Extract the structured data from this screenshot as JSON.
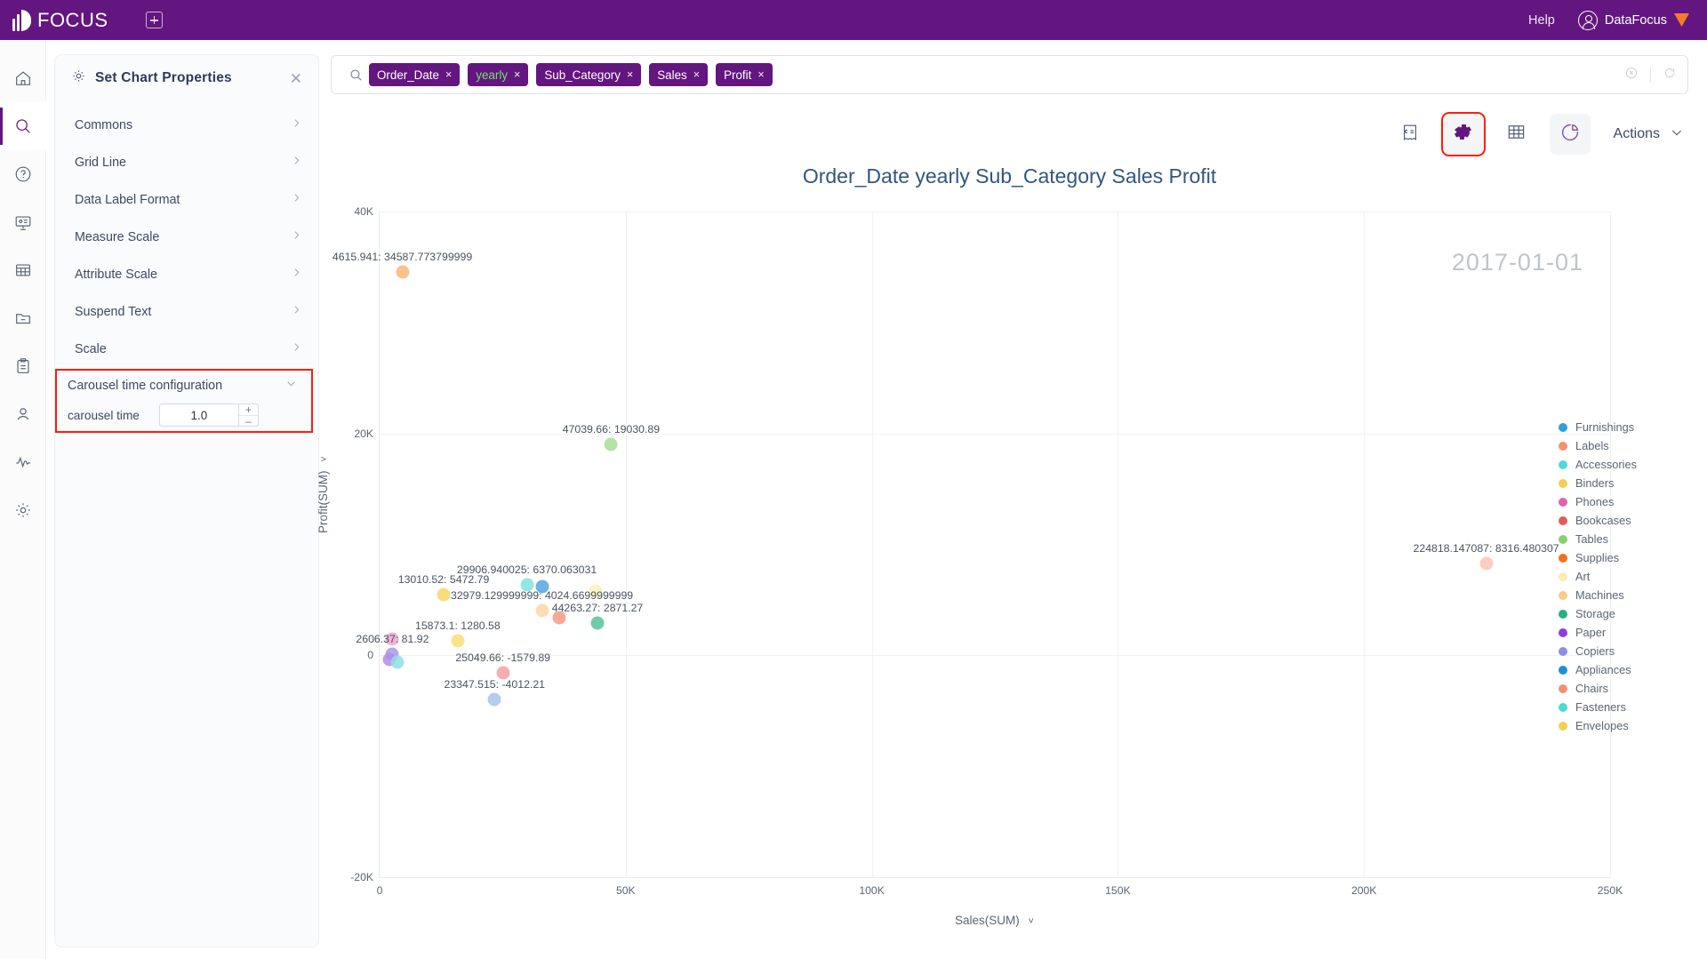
{
  "topbar": {
    "brand": "FOCUS",
    "add_icon": "plus-square-icon",
    "help": "Help",
    "user": "DataFocus"
  },
  "rail": [
    {
      "icon": "home-icon",
      "name": "home"
    },
    {
      "icon": "search-icon",
      "name": "search",
      "active": true
    },
    {
      "icon": "question-circle-icon",
      "name": "help"
    },
    {
      "icon": "presentation-icon",
      "name": "dashboard"
    },
    {
      "icon": "table-icon",
      "name": "table"
    },
    {
      "icon": "folder-minus-icon",
      "name": "resources"
    },
    {
      "icon": "clipboard-icon",
      "name": "tasks"
    },
    {
      "icon": "user-icon",
      "name": "account"
    },
    {
      "icon": "activity-icon",
      "name": "monitor"
    },
    {
      "icon": "gear-icon",
      "name": "settings"
    }
  ],
  "panel": {
    "title": "Set Chart Properties",
    "gear_icon": "gear-icon",
    "close_icon": "close-icon",
    "items": [
      {
        "label": "Commons"
      },
      {
        "label": "Grid Line"
      },
      {
        "label": "Data Label Format"
      },
      {
        "label": "Measure Scale"
      },
      {
        "label": "Attribute Scale"
      },
      {
        "label": "Suspend Text"
      },
      {
        "label": "Scale"
      }
    ],
    "carousel": {
      "section_label": "Carousel time configuration",
      "field_label": "carousel time",
      "value": "1.0",
      "increment": "+",
      "decrement": "–",
      "highlight_color": "#fd1d0a"
    }
  },
  "search": {
    "icon": "search-icon",
    "tokens": [
      {
        "label": "Order_Date",
        "remove": "×",
        "style": "plain"
      },
      {
        "label": "yearly",
        "remove": "×",
        "style": "green"
      },
      {
        "label": "Sub_Category",
        "remove": "×",
        "style": "plain"
      },
      {
        "label": "Sales",
        "remove": "×",
        "style": "plain"
      },
      {
        "label": "Profit",
        "remove": "×",
        "style": "plain"
      }
    ],
    "clear_icon": "circle-x-icon",
    "refresh_icon": "refresh-icon"
  },
  "toolbar": {
    "buttons": [
      {
        "icon": "receipt-icon",
        "name": "answer-view",
        "state": "plain"
      },
      {
        "icon": "gear-icon",
        "name": "chart-properties",
        "state": "highlighted"
      },
      {
        "icon": "table-icon",
        "name": "table-view",
        "state": "plain"
      },
      {
        "icon": "pie-chart-icon",
        "name": "chart-type",
        "state": "tinted"
      }
    ],
    "actions_label": "Actions",
    "actions_chevron": "chevron-down-icon"
  },
  "chart_data": {
    "type": "scatter",
    "title": "Order_Date yearly Sub_Category Sales Profit",
    "xlabel": "Sales(SUM)",
    "ylabel": "Profit(SUM)",
    "annotation": "2017-01-01",
    "xlim": [
      0,
      250000
    ],
    "ylim": [
      -20000,
      40000
    ],
    "xticks": [
      "0",
      "50K",
      "100K",
      "150K",
      "200K",
      "250K"
    ],
    "xtick_values": [
      0,
      50000,
      100000,
      150000,
      200000,
      250000
    ],
    "yticks": [
      "-20K",
      "0",
      "20K",
      "40K"
    ],
    "ytick_values": [
      -20000,
      0,
      20000,
      40000
    ],
    "grid": true,
    "legend_position": "right",
    "points": [
      {
        "series": "Machines",
        "x": 4615.941,
        "y": 34587.773799999,
        "label": "4615.941: 34587.773799999",
        "color": "#f9b87d"
      },
      {
        "series": "Tables",
        "x": 47039.66,
        "y": 19030.89,
        "label": "47039.66: 19030.89",
        "color": "#a8dd9a"
      },
      {
        "series": "Labels",
        "x": 224818.147087,
        "y": 8316.480307,
        "label": "224818.147087: 8316.480307",
        "color": "#fcc6b4"
      },
      {
        "series": "Accessories",
        "x": 29906.940025,
        "y": 6370.063031,
        "label": "29906.940025: 6370.063031",
        "color": "#7fe3e0"
      },
      {
        "series": "Appliances",
        "x": 32979.129999999,
        "y": 6200.0,
        "label": "",
        "color": "#57a5e0"
      },
      {
        "series": "Binders",
        "x": 13010.52,
        "y": 5472.79,
        "label": "13010.52: 5472.79",
        "color": "#f6d86b"
      },
      {
        "series": "Art",
        "x": 43900.0,
        "y": 5800.0,
        "label": "",
        "color": "#fbf0bc"
      },
      {
        "series": "Machines",
        "x": 32979.129999999,
        "y": 4024.6699999999,
        "label": "32979.129999999: 4024.6699999999",
        "color": "#fcd9a5"
      },
      {
        "series": "Chairs",
        "x": 36500.0,
        "y": 3400.0,
        "label": "",
        "color": "#f79b82"
      },
      {
        "series": "Storage",
        "x": 44263.27,
        "y": 2871.27,
        "label": "44263.27: 2871.27",
        "color": "#58c49a"
      },
      {
        "series": "Envelopes",
        "x": 15873.1,
        "y": 1280.58,
        "label": "15873.1: 1280.58",
        "color": "#f8e07a"
      },
      {
        "series": "Phones",
        "x": 2606.37,
        "y": 1500.0,
        "label": "",
        "color": "#f0a8d0"
      },
      {
        "series": "Copiers",
        "x": 2606.37,
        "y": 81.92,
        "label": "2606.37: 81.92",
        "color": "#a79ae8"
      },
      {
        "series": "Paper",
        "x": 1900.0,
        "y": -400.0,
        "label": "",
        "color": "#b58ce8"
      },
      {
        "series": "Fasteners",
        "x": 3600.0,
        "y": -600.0,
        "label": "",
        "color": "#8fe0e6"
      },
      {
        "series": "Bookcases",
        "x": 25049.66,
        "y": -1579.89,
        "label": "25049.66: -1579.89",
        "color": "#f5a1a1"
      },
      {
        "series": "Furnishings",
        "x": 23347.515,
        "y": -4012.21,
        "label": "23347.515: -4012.21",
        "color": "#a8c4ee"
      }
    ],
    "legend": [
      {
        "label": "Furnishings",
        "color": "#2ba0dd"
      },
      {
        "label": "Labels",
        "color": "#f58f72"
      },
      {
        "label": "Accessories",
        "color": "#4ddbd5"
      },
      {
        "label": "Binders",
        "color": "#f5cf4e"
      },
      {
        "label": "Phones",
        "color": "#e062b0"
      },
      {
        "label": "Bookcases",
        "color": "#e75a5a"
      },
      {
        "label": "Tables",
        "color": "#8bcf6f"
      },
      {
        "label": "Supplies",
        "color": "#f2711c"
      },
      {
        "label": "Art",
        "color": "#fbecb0"
      },
      {
        "label": "Machines",
        "color": "#fbc98a"
      },
      {
        "label": "Storage",
        "color": "#25b086"
      },
      {
        "label": "Paper",
        "color": "#8a3fe0"
      },
      {
        "label": "Copiers",
        "color": "#8f8ce8"
      },
      {
        "label": "Appliances",
        "color": "#1f8fd6"
      },
      {
        "label": "Chairs",
        "color": "#f58f72"
      },
      {
        "label": "Fasteners",
        "color": "#4ddbd5"
      },
      {
        "label": "Envelopes",
        "color": "#f5cf4e"
      }
    ]
  }
}
